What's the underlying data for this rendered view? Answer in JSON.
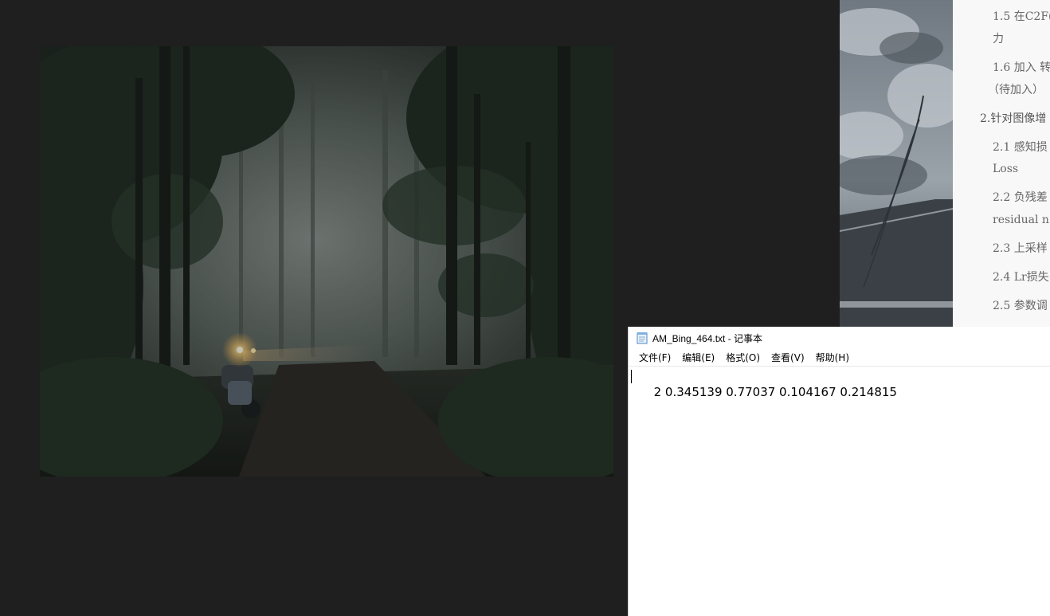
{
  "notepad": {
    "title": "AM_Bing_464.txt - 记事本",
    "menu": [
      "文件(F)",
      "编辑(E)",
      "格式(O)",
      "查看(V)",
      "帮助(H)"
    ],
    "content": "2 0.345139 0.77037 0.104167 0.214815"
  },
  "doc": {
    "toc": [
      {
        "level": 2,
        "text": "1.5 在C2F("
      },
      {
        "level": 2,
        "text": "力"
      },
      {
        "level": 2,
        "text": "1.6 加入 转"
      },
      {
        "level": 2,
        "text": "（待加入）"
      },
      {
        "level": 1,
        "text": "2.针对图像增"
      },
      {
        "level": 2,
        "text": "2.1 感知损"
      },
      {
        "level": 2,
        "text": "Loss"
      },
      {
        "level": 2,
        "text": "2.2 负残差"
      },
      {
        "level": 2,
        "text": "residual n"
      },
      {
        "level": 2,
        "text": "2.3 上采样"
      },
      {
        "level": 2,
        "text": "2.4 Lr损失"
      },
      {
        "level": 2,
        "text": "2.5 参数调"
      }
    ]
  },
  "colors": {
    "viewer_bg": "#1f1f1f",
    "headlight": "#ffd27a",
    "toc_text": "#666666"
  }
}
